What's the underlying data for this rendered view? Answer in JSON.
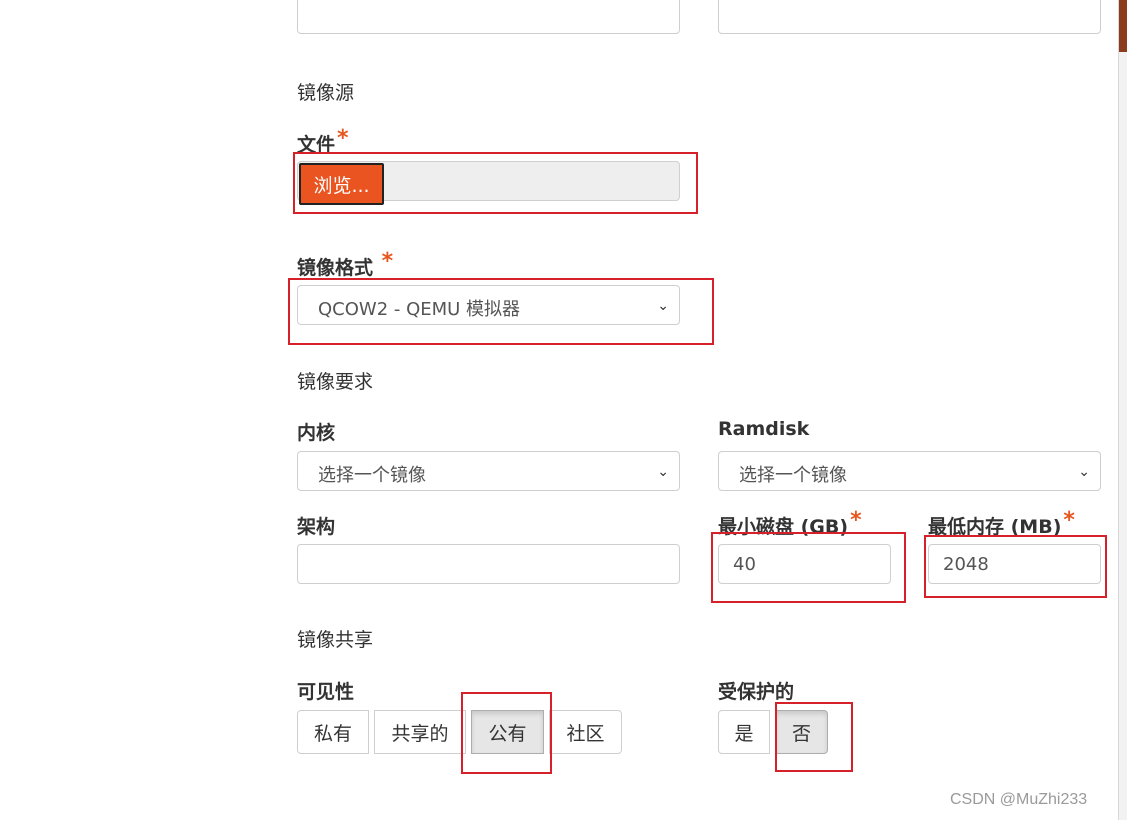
{
  "sections": {
    "source": "镜像源",
    "requirements": "镜像要求",
    "sharing": "镜像共享"
  },
  "file": {
    "label": "文件",
    "required_mark": "*",
    "browse_label": "浏览..."
  },
  "format": {
    "label": "镜像格式",
    "required_mark": "*",
    "selected": "QCOW2 - QEMU 模拟器"
  },
  "kernel": {
    "label": "内核",
    "selected": "选择一个镜像"
  },
  "ramdisk": {
    "label": "Ramdisk",
    "selected": "选择一个镜像"
  },
  "architecture": {
    "label": "架构",
    "value": ""
  },
  "min_disk": {
    "label": "最小磁盘 (GB)",
    "required_mark": "*",
    "value": "40"
  },
  "min_ram": {
    "label": "最低内存 (MB)",
    "required_mark": "*",
    "value": "2048"
  },
  "visibility": {
    "label": "可见性",
    "options": [
      "私有",
      "共享的",
      "公有",
      "社区"
    ],
    "selected": "公有"
  },
  "protected": {
    "label": "受保护的",
    "options": [
      "是",
      "否"
    ],
    "selected": "否"
  },
  "icons": {
    "caret": "chevron-down-icon"
  },
  "colors": {
    "accent": "#e95420",
    "highlight_box": "#d6202a"
  },
  "watermark": "CSDN @MuZhi233"
}
